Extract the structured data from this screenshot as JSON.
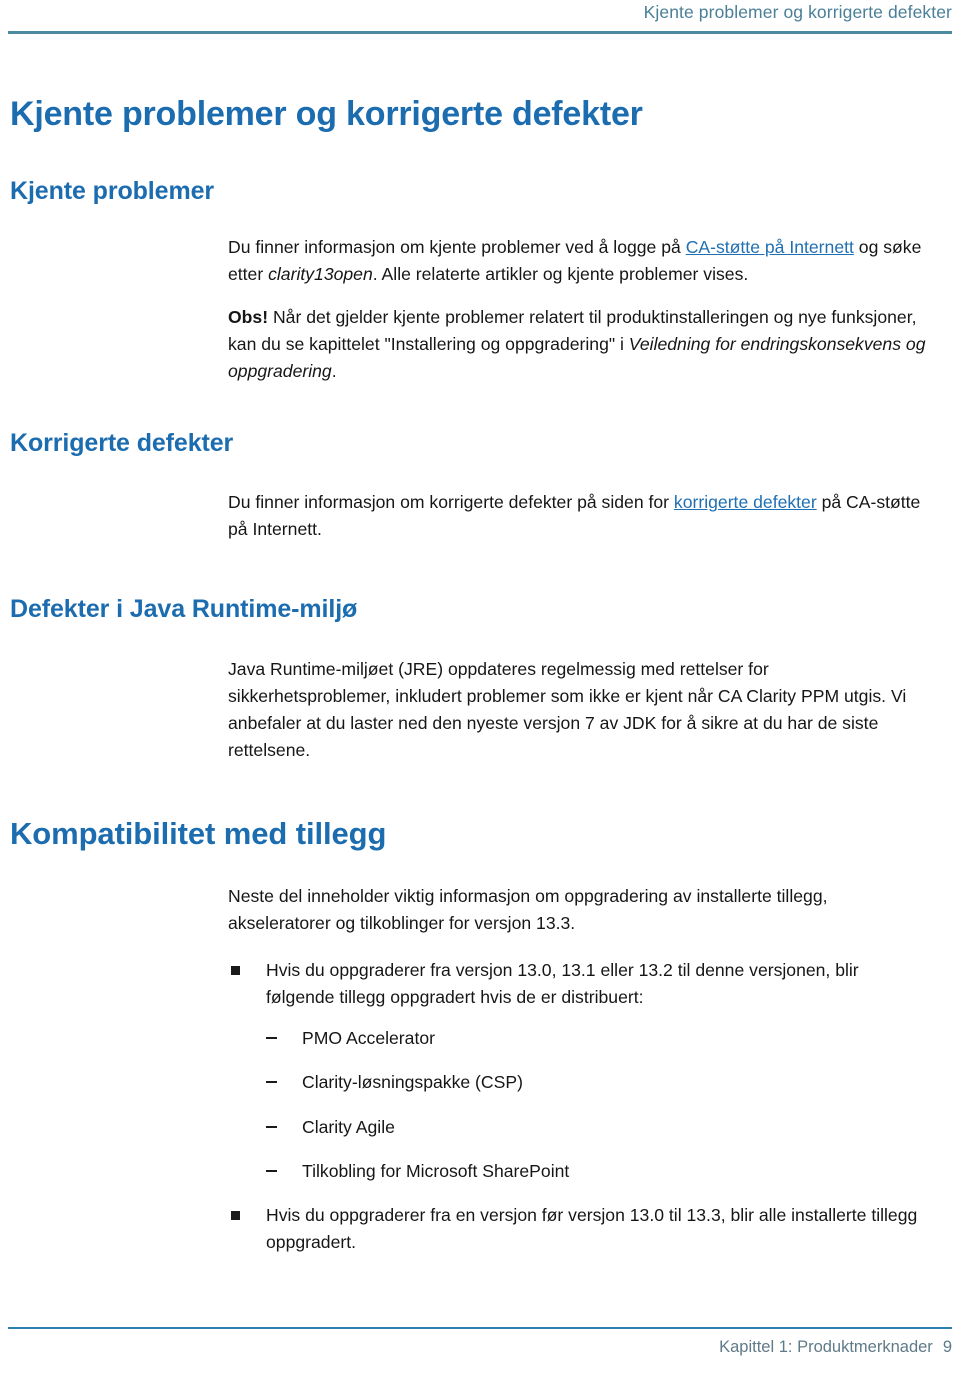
{
  "header": {
    "running_title": "Kjente problemer og korrigerte defekter",
    "rule_color": "#4b8aa1"
  },
  "theme": {
    "heading_color": "#1c6cb0",
    "link_color": "#1f6fb2",
    "body_color": "#161616",
    "footer_color": "#5f7a88",
    "footer_rule_color": "#2b7db0"
  },
  "doc": {
    "title": "Kjente problemer og korrigerte defekter"
  },
  "sections": {
    "kjente_problemer": {
      "heading": "Kjente problemer",
      "para1_before_link": "Du finner informasjon om kjente problemer ved å logge på ",
      "para1_link": "CA-støtte på Internett",
      "para1_after_link": " og søke etter ",
      "para1_italic": "clarity13open",
      "para1_tail": ". Alle relaterte artikler og kjente problemer vises.",
      "note_label": "Obs!",
      "note_text": " Når det gjelder kjente problemer relatert til produktinstalleringen og nye funksjoner, kan du se kapittelet \"Installering og oppgradering\" i ",
      "note_italic": "Veiledning for endringskonsekvens og oppgradering",
      "note_tail": "."
    },
    "korrigerte_defekter": {
      "heading": "Korrigerte defekter",
      "para_before_link": "Du finner informasjon om korrigerte defekter på siden for ",
      "para_link": "korrigerte defekter",
      "para_after_link": " på CA-støtte på Internett."
    },
    "java_runtime": {
      "heading": "Defekter i Java Runtime-miljø",
      "para": "Java Runtime-miljøet (JRE) oppdateres regelmessig med rettelser for sikkerhetsproblemer, inkludert problemer som ikke er kjent når CA Clarity PPM utgis. Vi anbefaler at du laster ned den nyeste versjon 7 av JDK for å sikre at du har de siste rettelsene."
    },
    "kompatibilitet": {
      "heading": "Kompatibilitet med tillegg",
      "intro": "Neste del inneholder viktig informasjon om oppgradering av installerte tillegg, akseleratorer og tilkoblinger for versjon 13.3.",
      "bullets": [
        {
          "text": "Hvis du oppgraderer fra versjon 13.0, 13.1 eller 13.2 til denne versjonen, blir følgende tillegg oppgradert hvis de er distribuert:",
          "subitems": [
            "PMO Accelerator",
            "Clarity-løsningspakke (CSP)",
            "Clarity Agile",
            "Tilkobling for Microsoft SharePoint"
          ]
        },
        {
          "text": "Hvis du oppgraderer fra en versjon før versjon 13.0 til 13.3, blir alle installerte tillegg oppgradert.",
          "subitems": []
        }
      ]
    }
  },
  "footer": {
    "chapter_text": "Kapittel 1: Produktmerknader",
    "page_number": "9"
  }
}
